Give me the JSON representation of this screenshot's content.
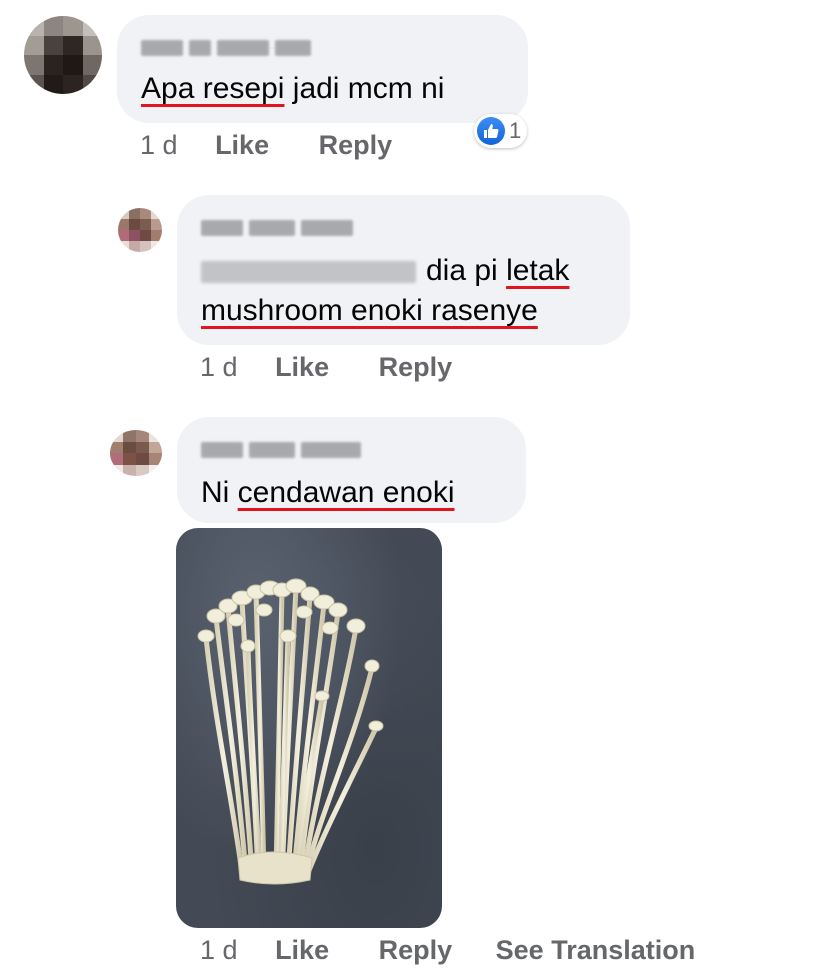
{
  "comments": [
    {
      "text_before": "",
      "underlined": "Apa resepi",
      "text_after": " jadi mcm ni",
      "time": "1 d",
      "like_label": "Like",
      "reply_label": "Reply",
      "reaction_count": "1",
      "reaction_icon": "thumbs-up-icon"
    },
    {
      "line1_text": "dia pi ",
      "line1_underlined": "letak",
      "line2_underlined": "mushroom enoki rasenye",
      "time": "1 d",
      "like_label": "Like",
      "reply_label": "Reply"
    },
    {
      "text_before": "Ni ",
      "underlined": "cendawan enoki",
      "time": "1 d",
      "like_label": "Like",
      "reply_label": "Reply",
      "translation_label": "See Translation"
    }
  ],
  "colors": {
    "bubble": "#f0f2f5",
    "meta_text": "#65676b",
    "spellcheck_underline": "#e0151f",
    "like_blue": "#1877f2"
  }
}
